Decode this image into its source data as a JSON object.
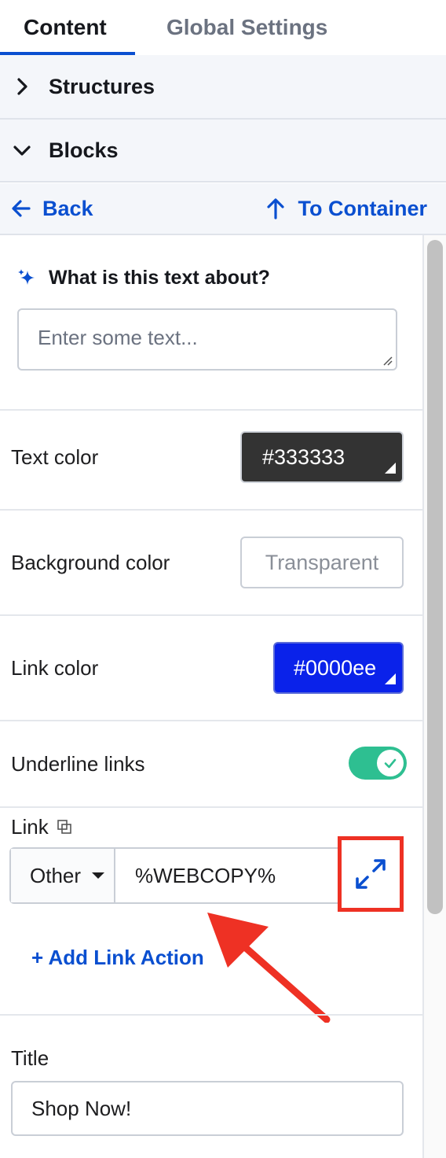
{
  "tabs": [
    {
      "label": "Content",
      "active": true
    },
    {
      "label": "Global Settings",
      "active": false
    }
  ],
  "accordion": {
    "structures_label": "Structures",
    "blocks_label": "Blocks"
  },
  "nav": {
    "back_label": "Back",
    "to_container_label": "To Container"
  },
  "ai_prompt": {
    "label": "What is this text about?",
    "placeholder": "Enter some text..."
  },
  "settings": {
    "text_color": {
      "label": "Text color",
      "value": "#333333"
    },
    "background_color": {
      "label": "Background color",
      "value": "Transparent"
    },
    "link_color": {
      "label": "Link color",
      "value": "#0000ee"
    },
    "underline_links": {
      "label": "Underline links",
      "enabled": true
    }
  },
  "link": {
    "label": "Link",
    "type": "Other",
    "value": "%WEBCOPY%",
    "add_action_label": "+ Add Link Action"
  },
  "title_field": {
    "label": "Title",
    "value": "Shop Now!"
  },
  "colors": {
    "accent": "#0a4fd0",
    "toggle_on": "#2ebf91",
    "annotation": "#ee3124"
  }
}
